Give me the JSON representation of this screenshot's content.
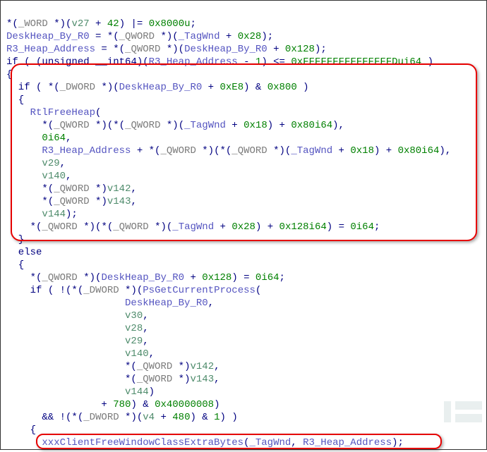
{
  "line01": {
    "p1": "*(",
    "p2": "_WORD",
    "p3": " *)(",
    "p4": "v27",
    "p5": " + ",
    "p6": "42",
    "p7": ") |= ",
    "p8": "0x8000u",
    "p9": ";"
  },
  "line02": {
    "p1": "DeskHeap_By_R0",
    "p2": " = *(",
    "p3": "_QWORD",
    "p4": " *)(",
    "p5": "_TagWnd",
    "p6": " + ",
    "p7": "0x28",
    "p8": ");"
  },
  "line03": {
    "p1": "R3_Heap_Address",
    "p2": " = *(",
    "p3": "_QWORD",
    "p4": " *)(",
    "p5": "DeskHeap_By_R0",
    "p6": " + ",
    "p7": "0x128",
    "p8": ");"
  },
  "line04": {
    "p1": "if",
    "p2": " ( (",
    "p3": "unsigned __int64",
    "p4": ")(",
    "p5": "R3_Heap_Address",
    "p6": " - ",
    "p7": "1",
    "p8": ") <= ",
    "p9": "0xFFFFFFFFFFFFFFFDui64",
    "p10": " )"
  },
  "line05": {
    "p1": "{"
  },
  "line06": {
    "p1": "  if",
    "p2": " ( *(",
    "p3": "_DWORD",
    "p4": " *)(",
    "p5": "DeskHeap_By_R0",
    "p6": " + ",
    "p7": "0xE8",
    "p8": ") & ",
    "p9": "0x800",
    "p10": " )"
  },
  "line07": {
    "p1": "  {"
  },
  "line08": {
    "p1": "    RtlFreeHeap",
    "p2": "("
  },
  "line09": {
    "p1": "      *(",
    "p2": "_QWORD",
    "p3": " *)(*(",
    "p4": "_QWORD",
    "p5": " *)(",
    "p6": "_TagWnd",
    "p7": " + ",
    "p8": "0x18",
    "p9": ") + ",
    "p10": "0x80i64",
    "p11": "),"
  },
  "line10": {
    "p1": "      ",
    "p2": "0i64",
    "p3": ","
  },
  "line11": {
    "p1": "      R3_Heap_Address",
    "p2": " + *(",
    "p3": "_QWORD",
    "p4": " *)(*(",
    "p5": "_QWORD",
    "p6": " *)(",
    "p7": "_TagWnd",
    "p8": " + ",
    "p9": "0x18",
    "p10": ") + ",
    "p11": "0x80i64",
    "p12": "),"
  },
  "line12": {
    "p1": "      ",
    "p2": "v29",
    "p3": ","
  },
  "line13": {
    "p1": "      ",
    "p2": "v140",
    "p3": ","
  },
  "line14": {
    "p1": "      *(",
    "p2": "_QWORD",
    "p3": " *)",
    "p4": "v142",
    "p5": ","
  },
  "line15": {
    "p1": "      *(",
    "p2": "_QWORD",
    "p3": " *)",
    "p4": "v143",
    "p5": ","
  },
  "line16": {
    "p1": "      ",
    "p2": "v144",
    "p3": ");"
  },
  "line17": {
    "p1": "    *(",
    "p2": "_QWORD",
    "p3": " *)(*(",
    "p4": "_QWORD",
    "p5": " *)(",
    "p6": "_TagWnd",
    "p7": " + ",
    "p8": "0x28",
    "p9": ") + ",
    "p10": "0x128i64",
    "p11": ") = ",
    "p12": "0i64",
    "p13": ";"
  },
  "line18": {
    "p1": "  }"
  },
  "line19": {
    "p1": "  else"
  },
  "line20": {
    "p1": "  {"
  },
  "line21": {
    "p1": "    *(",
    "p2": "_QWORD",
    "p3": " *)(",
    "p4": "DeskHeap_By_R0",
    "p5": " + ",
    "p6": "0x128",
    "p7": ") = ",
    "p8": "0i64",
    "p9": ";"
  },
  "line22": {
    "p1": "    if",
    "p2": " ( !(*(",
    "p3": "_DWORD",
    "p4": " *)(",
    "p5": "PsGetCurrentProcess",
    "p6": "("
  },
  "line23": {
    "p1": "                    ",
    "p2": "DeskHeap_By_R0",
    "p3": ","
  },
  "line24": {
    "p1": "                    ",
    "p2": "v30",
    "p3": ","
  },
  "line25": {
    "p1": "                    ",
    "p2": "v28",
    "p3": ","
  },
  "line26": {
    "p1": "                    ",
    "p2": "v29",
    "p3": ","
  },
  "line27": {
    "p1": "                    ",
    "p2": "v140",
    "p3": ","
  },
  "line28": {
    "p1": "                    *(",
    "p2": "_QWORD",
    "p3": " *)",
    "p4": "v142",
    "p5": ","
  },
  "line29": {
    "p1": "                    *(",
    "p2": "_QWORD",
    "p3": " *)",
    "p4": "v143",
    "p5": ","
  },
  "line30": {
    "p1": "                    ",
    "p2": "v144",
    "p3": ")"
  },
  "line31": {
    "p1": "                + ",
    "p2": "780",
    "p3": ") & ",
    "p4": "0x40000008",
    "p5": ")"
  },
  "line32": {
    "p1": "      && !(*(",
    "p2": "_DWORD",
    "p3": " *)(",
    "p4": "v4",
    "p5": " + ",
    "p6": "480",
    "p7": ") & ",
    "p8": "1",
    "p9": ") )"
  },
  "line33": {
    "p1": "    {"
  },
  "line34": {
    "p1": "      xxxClientFreeWindowClassExtraBytes",
    "p2": "(",
    "p3": "_TagWnd",
    "p4": ", ",
    "p5": "R3_Heap_Address",
    "p6": ");"
  }
}
